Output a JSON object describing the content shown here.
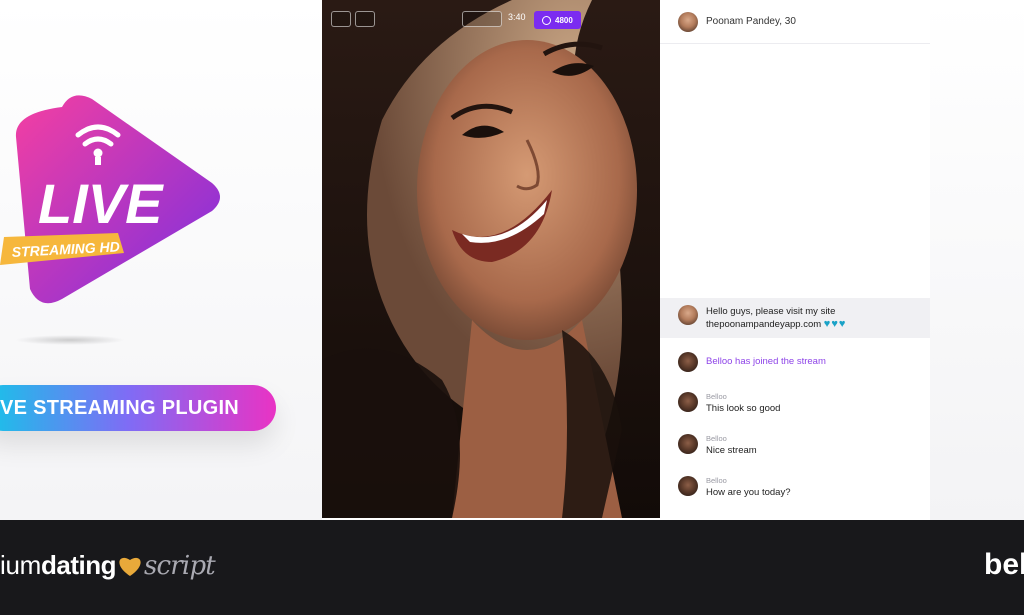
{
  "promo": {
    "logo_word": "LIVE",
    "logo_ribbon": "STREAMING HD",
    "plugin_label": "VE STREAMING PLUGIN",
    "colors": {
      "gradient_start": "#f53fa1",
      "gradient_end": "#7a2fe0",
      "ribbon": "#f6b73c",
      "pill_start": "#14c6e8",
      "pill_end": "#e933c4"
    }
  },
  "video": {
    "time": "3:40",
    "live_label": "4800",
    "accent": "#7b2cf0"
  },
  "chat": {
    "streamer": "Poonam Pandey, 30",
    "pinned": {
      "line1": "Hello guys, please visit my site",
      "line2": "thepoonampandeyapp.com",
      "hearts": "♥♥♥"
    },
    "join_notice": "Belloo has joined the stream",
    "messages": [
      {
        "author": "Belloo",
        "text": "This look so good"
      },
      {
        "author": "Belloo",
        "text": "Nice stream"
      },
      {
        "author": "Belloo",
        "text": "How are you today?"
      }
    ]
  },
  "footer": {
    "brand_prefix": "ium",
    "brand_bold": "dating",
    "brand_suffix": "script",
    "brand_right": "bel",
    "heart_color": "#e8a93a"
  }
}
